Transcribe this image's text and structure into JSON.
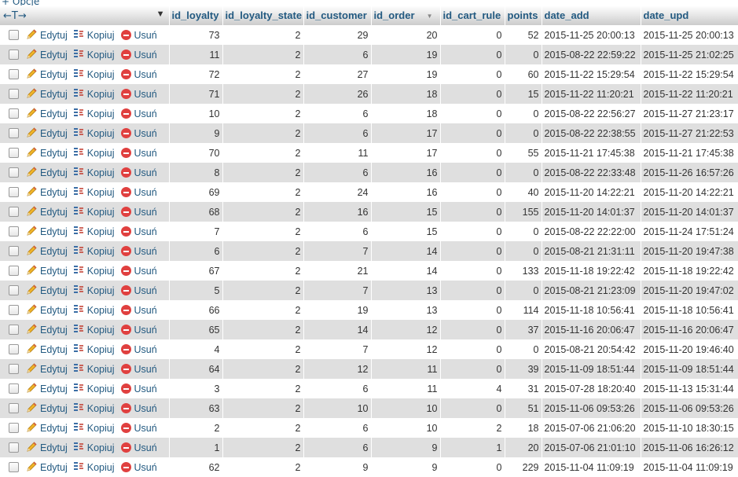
{
  "top": {
    "options_link": "+ Opcje",
    "arrows": "←T→"
  },
  "columns": [
    "id_loyalty",
    "id_loyalty_state",
    "id_customer",
    "id_order",
    "id_cart_rule",
    "points",
    "date_add",
    "date_upd"
  ],
  "actions": {
    "edit": "Edytuj",
    "copy": "Kopiuj",
    "delete": "Usuń"
  },
  "rows": [
    {
      "id_loyalty": "73",
      "id_loyalty_state": "2",
      "id_customer": "29",
      "id_order": "20",
      "id_cart_rule": "0",
      "points": "52",
      "date_add": "2015-11-25 20:00:13",
      "date_upd": "2015-11-25 20:00:13"
    },
    {
      "id_loyalty": "11",
      "id_loyalty_state": "2",
      "id_customer": "6",
      "id_order": "19",
      "id_cart_rule": "0",
      "points": "0",
      "date_add": "2015-08-22 22:59:22",
      "date_upd": "2015-11-25 21:02:25"
    },
    {
      "id_loyalty": "72",
      "id_loyalty_state": "2",
      "id_customer": "27",
      "id_order": "19",
      "id_cart_rule": "0",
      "points": "60",
      "date_add": "2015-11-22 15:29:54",
      "date_upd": "2015-11-22 15:29:54"
    },
    {
      "id_loyalty": "71",
      "id_loyalty_state": "2",
      "id_customer": "26",
      "id_order": "18",
      "id_cart_rule": "0",
      "points": "15",
      "date_add": "2015-11-22 11:20:21",
      "date_upd": "2015-11-22 11:20:21"
    },
    {
      "id_loyalty": "10",
      "id_loyalty_state": "2",
      "id_customer": "6",
      "id_order": "18",
      "id_cart_rule": "0",
      "points": "0",
      "date_add": "2015-08-22 22:56:27",
      "date_upd": "2015-11-27 21:23:17"
    },
    {
      "id_loyalty": "9",
      "id_loyalty_state": "2",
      "id_customer": "6",
      "id_order": "17",
      "id_cart_rule": "0",
      "points": "0",
      "date_add": "2015-08-22 22:38:55",
      "date_upd": "2015-11-27 21:22:53"
    },
    {
      "id_loyalty": "70",
      "id_loyalty_state": "2",
      "id_customer": "11",
      "id_order": "17",
      "id_cart_rule": "0",
      "points": "55",
      "date_add": "2015-11-21 17:45:38",
      "date_upd": "2015-11-21 17:45:38"
    },
    {
      "id_loyalty": "8",
      "id_loyalty_state": "2",
      "id_customer": "6",
      "id_order": "16",
      "id_cart_rule": "0",
      "points": "0",
      "date_add": "2015-08-22 22:33:48",
      "date_upd": "2015-11-26 16:57:26"
    },
    {
      "id_loyalty": "69",
      "id_loyalty_state": "2",
      "id_customer": "24",
      "id_order": "16",
      "id_cart_rule": "0",
      "points": "40",
      "date_add": "2015-11-20 14:22:21",
      "date_upd": "2015-11-20 14:22:21"
    },
    {
      "id_loyalty": "68",
      "id_loyalty_state": "2",
      "id_customer": "16",
      "id_order": "15",
      "id_cart_rule": "0",
      "points": "155",
      "date_add": "2015-11-20 14:01:37",
      "date_upd": "2015-11-20 14:01:37"
    },
    {
      "id_loyalty": "7",
      "id_loyalty_state": "2",
      "id_customer": "6",
      "id_order": "15",
      "id_cart_rule": "0",
      "points": "0",
      "date_add": "2015-08-22 22:22:00",
      "date_upd": "2015-11-24 17:51:24"
    },
    {
      "id_loyalty": "6",
      "id_loyalty_state": "2",
      "id_customer": "7",
      "id_order": "14",
      "id_cart_rule": "0",
      "points": "0",
      "date_add": "2015-08-21 21:31:11",
      "date_upd": "2015-11-20 19:47:38"
    },
    {
      "id_loyalty": "67",
      "id_loyalty_state": "2",
      "id_customer": "21",
      "id_order": "14",
      "id_cart_rule": "0",
      "points": "133",
      "date_add": "2015-11-18 19:22:42",
      "date_upd": "2015-11-18 19:22:42"
    },
    {
      "id_loyalty": "5",
      "id_loyalty_state": "2",
      "id_customer": "7",
      "id_order": "13",
      "id_cart_rule": "0",
      "points": "0",
      "date_add": "2015-08-21 21:23:09",
      "date_upd": "2015-11-20 19:47:02"
    },
    {
      "id_loyalty": "66",
      "id_loyalty_state": "2",
      "id_customer": "19",
      "id_order": "13",
      "id_cart_rule": "0",
      "points": "114",
      "date_add": "2015-11-18 10:56:41",
      "date_upd": "2015-11-18 10:56:41"
    },
    {
      "id_loyalty": "65",
      "id_loyalty_state": "2",
      "id_customer": "14",
      "id_order": "12",
      "id_cart_rule": "0",
      "points": "37",
      "date_add": "2015-11-16 20:06:47",
      "date_upd": "2015-11-16 20:06:47"
    },
    {
      "id_loyalty": "4",
      "id_loyalty_state": "2",
      "id_customer": "7",
      "id_order": "12",
      "id_cart_rule": "0",
      "points": "0",
      "date_add": "2015-08-21 20:54:42",
      "date_upd": "2015-11-20 19:46:40"
    },
    {
      "id_loyalty": "64",
      "id_loyalty_state": "2",
      "id_customer": "12",
      "id_order": "11",
      "id_cart_rule": "0",
      "points": "39",
      "date_add": "2015-11-09 18:51:44",
      "date_upd": "2015-11-09 18:51:44"
    },
    {
      "id_loyalty": "3",
      "id_loyalty_state": "2",
      "id_customer": "6",
      "id_order": "11",
      "id_cart_rule": "4",
      "points": "31",
      "date_add": "2015-07-28 18:20:40",
      "date_upd": "2015-11-13 15:31:44"
    },
    {
      "id_loyalty": "63",
      "id_loyalty_state": "2",
      "id_customer": "10",
      "id_order": "10",
      "id_cart_rule": "0",
      "points": "51",
      "date_add": "2015-11-06 09:53:26",
      "date_upd": "2015-11-06 09:53:26"
    },
    {
      "id_loyalty": "2",
      "id_loyalty_state": "2",
      "id_customer": "6",
      "id_order": "10",
      "id_cart_rule": "2",
      "points": "18",
      "date_add": "2015-07-06 21:06:20",
      "date_upd": "2015-11-10 18:30:15"
    },
    {
      "id_loyalty": "1",
      "id_loyalty_state": "2",
      "id_customer": "6",
      "id_order": "9",
      "id_cart_rule": "1",
      "points": "20",
      "date_add": "2015-07-06 21:01:10",
      "date_upd": "2015-11-06 16:26:12"
    },
    {
      "id_loyalty": "62",
      "id_loyalty_state": "2",
      "id_customer": "9",
      "id_order": "9",
      "id_cart_rule": "0",
      "points": "229",
      "date_add": "2015-11-04 11:09:19",
      "date_upd": "2015-11-04 11:09:19"
    }
  ]
}
